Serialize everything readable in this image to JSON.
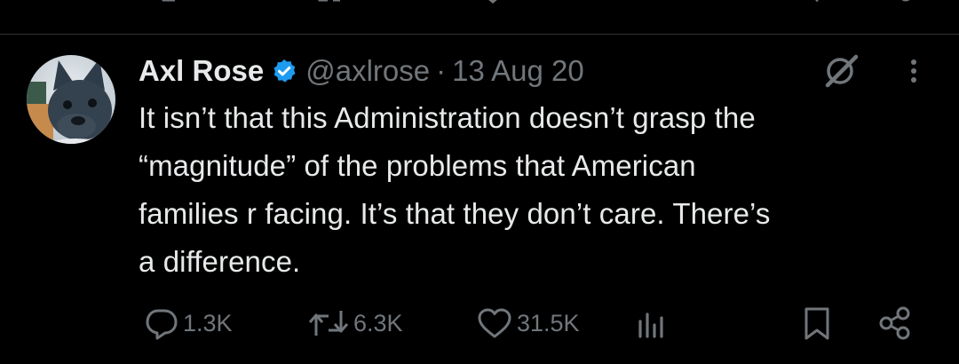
{
  "tweet": {
    "display_name": "Axl Rose",
    "handle": "@axlrose",
    "separator": "·",
    "date": "13 Aug 20",
    "text_lines": [
      "It isn’t that this Administration doesn’t grasp the",
      "“magnitude” of the problems that American",
      "families r facing. It’s that they don’t care. There’s",
      "a difference."
    ],
    "replies": "1.3K",
    "reposts": "6.3K",
    "likes": "31.5K"
  },
  "icons": {
    "verified": "verified-badge-icon",
    "grok": "grok-icon",
    "more": "more-options-icon",
    "reply": "reply-icon",
    "repost": "repost-icon",
    "like": "like-icon",
    "views": "views-icon",
    "bookmark": "bookmark-icon",
    "share": "share-icon"
  },
  "colors": {
    "background": "#000000",
    "text": "#e7e9ea",
    "muted": "#71767b",
    "divider": "#2f3336",
    "verified": "#1d9bf0"
  }
}
